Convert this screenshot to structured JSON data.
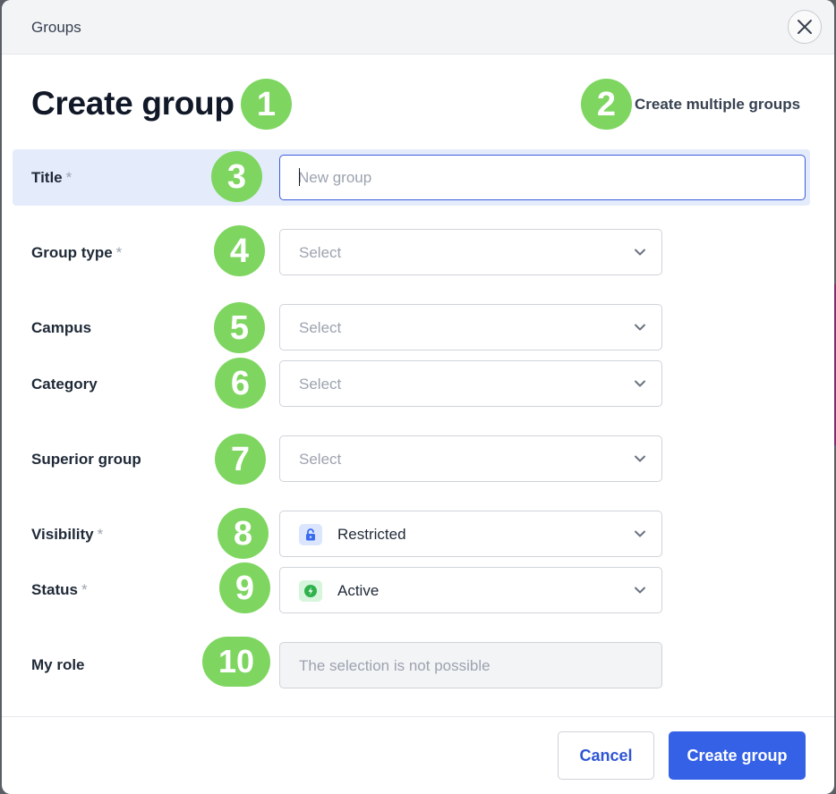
{
  "topbar": {
    "title": "Groups"
  },
  "header": {
    "title": "Create group",
    "multiple_link": "Create multiple groups"
  },
  "badges": [
    "1",
    "2",
    "3",
    "4",
    "5",
    "6",
    "7",
    "8",
    "9",
    "10"
  ],
  "required_marker": "*",
  "fields": {
    "title": {
      "label": "Title",
      "placeholder": "New group",
      "value": ""
    },
    "group_type": {
      "label": "Group type",
      "value": "Select"
    },
    "campus": {
      "label": "Campus",
      "value": "Select"
    },
    "category": {
      "label": "Category",
      "value": "Select"
    },
    "superior_group": {
      "label": "Superior group",
      "value": "Select"
    },
    "visibility": {
      "label": "Visibility",
      "value": "Restricted",
      "icon": "lock-open-icon"
    },
    "status": {
      "label": "Status",
      "value": "Active",
      "icon": "bolt-icon"
    },
    "my_role": {
      "label": "My role",
      "value": "The selection is not possible"
    }
  },
  "footer": {
    "cancel_label": "Cancel",
    "create_label": "Create group"
  },
  "colors": {
    "badge": "#7ed661",
    "primary": "#3561e6",
    "highlight_row": "#e4ecfc",
    "visibility_icon_bg": "#dbe6fe",
    "status_icon_bg": "#d7f5dc"
  }
}
